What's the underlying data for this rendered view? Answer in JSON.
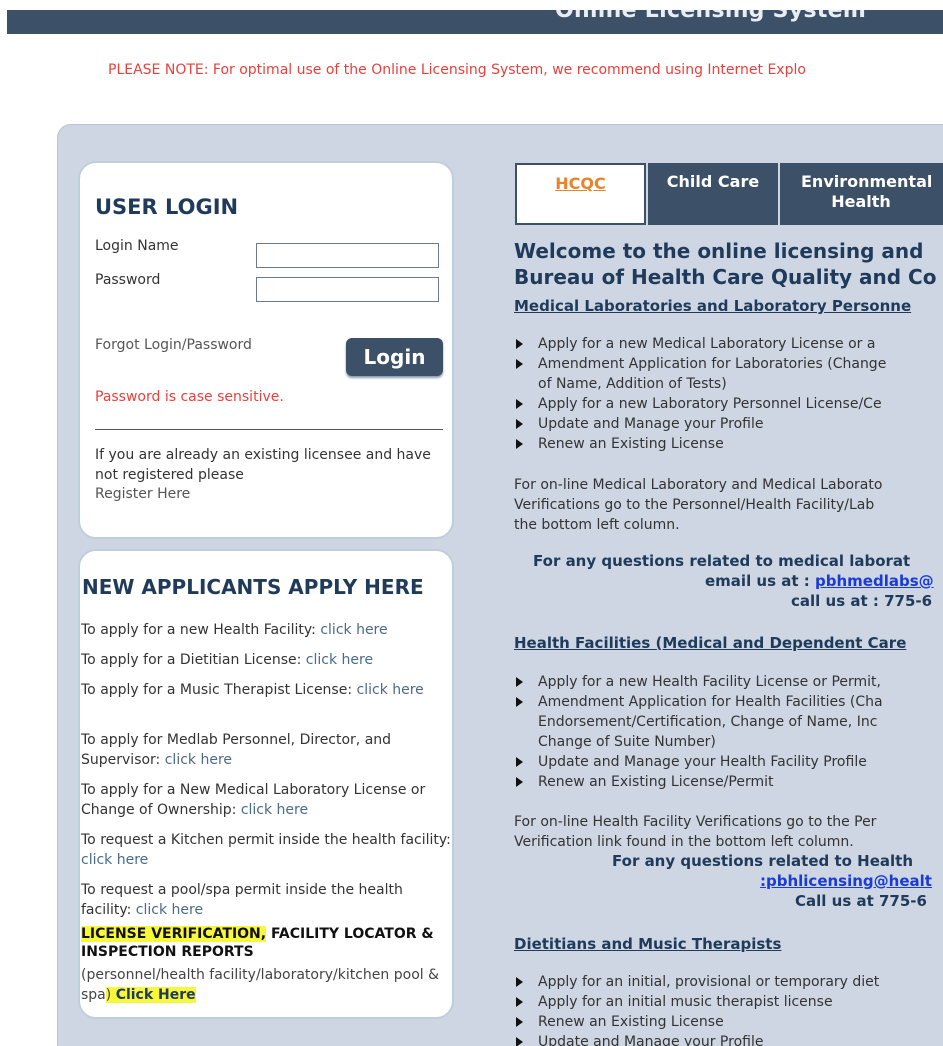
{
  "header": {
    "title": "Online Licensing System"
  },
  "notice": "PLEASE NOTE: For optimal use of the Online Licensing System, we recommend using Internet Explo",
  "login": {
    "title": "USER LOGIN",
    "login_name_label": "Login Name",
    "password_label": "Password",
    "forgot": "Forgot Login/Password",
    "button": "Login",
    "case_note": "Password is case sensitive.",
    "existing_text": "If you are already an existing licensee and have not registered please",
    "register": "Register Here"
  },
  "apply": {
    "title": "NEW APPLICANTS APPLY HERE",
    "items": [
      {
        "text": "To apply for a new Health Facility: ",
        "link": "click here"
      },
      {
        "text": "To apply for a Dietitian License: ",
        "link": "click here"
      },
      {
        "text": "To apply for a Music Therapist License: ",
        "link": "click here"
      },
      {
        "text": "To apply for Medlab Personnel, Director, and Supervisor: ",
        "link": "click here"
      },
      {
        "text": "To apply for a New Medical Laboratory License or Change of Ownership: ",
        "link": "click here"
      },
      {
        "text": "To request a Kitchen permit inside the health facility: ",
        "link": "click here"
      },
      {
        "text": "To request a pool/spa permit inside the health facility: ",
        "link": "click here"
      }
    ],
    "verification_hl": "LICENSE VERIFICATION,",
    "verification_rest": " FACILITY LOCATOR & INSPECTION REPORTS",
    "verification_sub_a": "(personnel/health facility/laboratory/kitchen pool & spa",
    "verification_sub_b": ")",
    "verification_click": "Click Here"
  },
  "tabs": [
    {
      "label": "HCQC",
      "active": true
    },
    {
      "label": "Child Care",
      "active": false
    },
    {
      "label": "Environmental Health",
      "active": false
    }
  ],
  "main": {
    "welcome_1": "Welcome to the online licensing and",
    "welcome_2": "Bureau of Health Care Quality and Co",
    "sec1_title": "Medical Laboratories and Laboratory Personne",
    "sec1_items": [
      "Apply for a new Medical Laboratory License or a",
      "Amendment Application for Laboratories (Change",
      "of Name, Addition of Tests)",
      "Apply for a new Laboratory Personnel License/Ce",
      "Update and Manage your Profile",
      "Renew an Existing License"
    ],
    "sec1_para_1": "For on-line Medical Laboratory and Medical Laborato",
    "sec1_para_2": "Verifications go to the Personnel/Health Facility/Lab",
    "sec1_para_3": "the bottom left column.",
    "sec1_q": "For any questions related to medical laborat",
    "sec1_email_label": "email us at : ",
    "sec1_email": "pbhmedlabs@",
    "sec1_call": "call us at : 775-6",
    "sec2_title": "Health Facilities (Medical and Dependent Care",
    "sec2_items": [
      "Apply for a new Health Facility License or Permit,",
      "Amendment Application for Health Facilities (Cha",
      "Endorsement/Certification, Change of Name, Inc",
      "Change of Suite Number)",
      "Update and Manage your Health Facility Profile",
      "Renew an Existing License/Permit"
    ],
    "sec2_para_1": "For on-line Health Facility Verifications go to the Per",
    "sec2_para_2": "Verification link found in the bottom left column.",
    "sec2_q": "For any questions related to Health",
    "sec2_email": ":pbhlicensing@healt",
    "sec2_call": "Call us at 775-6",
    "sec3_title": "Dietitians and Music Therapists",
    "sec3_items": [
      "Apply for an initial, provisional or temporary diet",
      "Apply for an initial music therapist license",
      "Renew an Existing License",
      "Update and Manage your Profile"
    ]
  }
}
